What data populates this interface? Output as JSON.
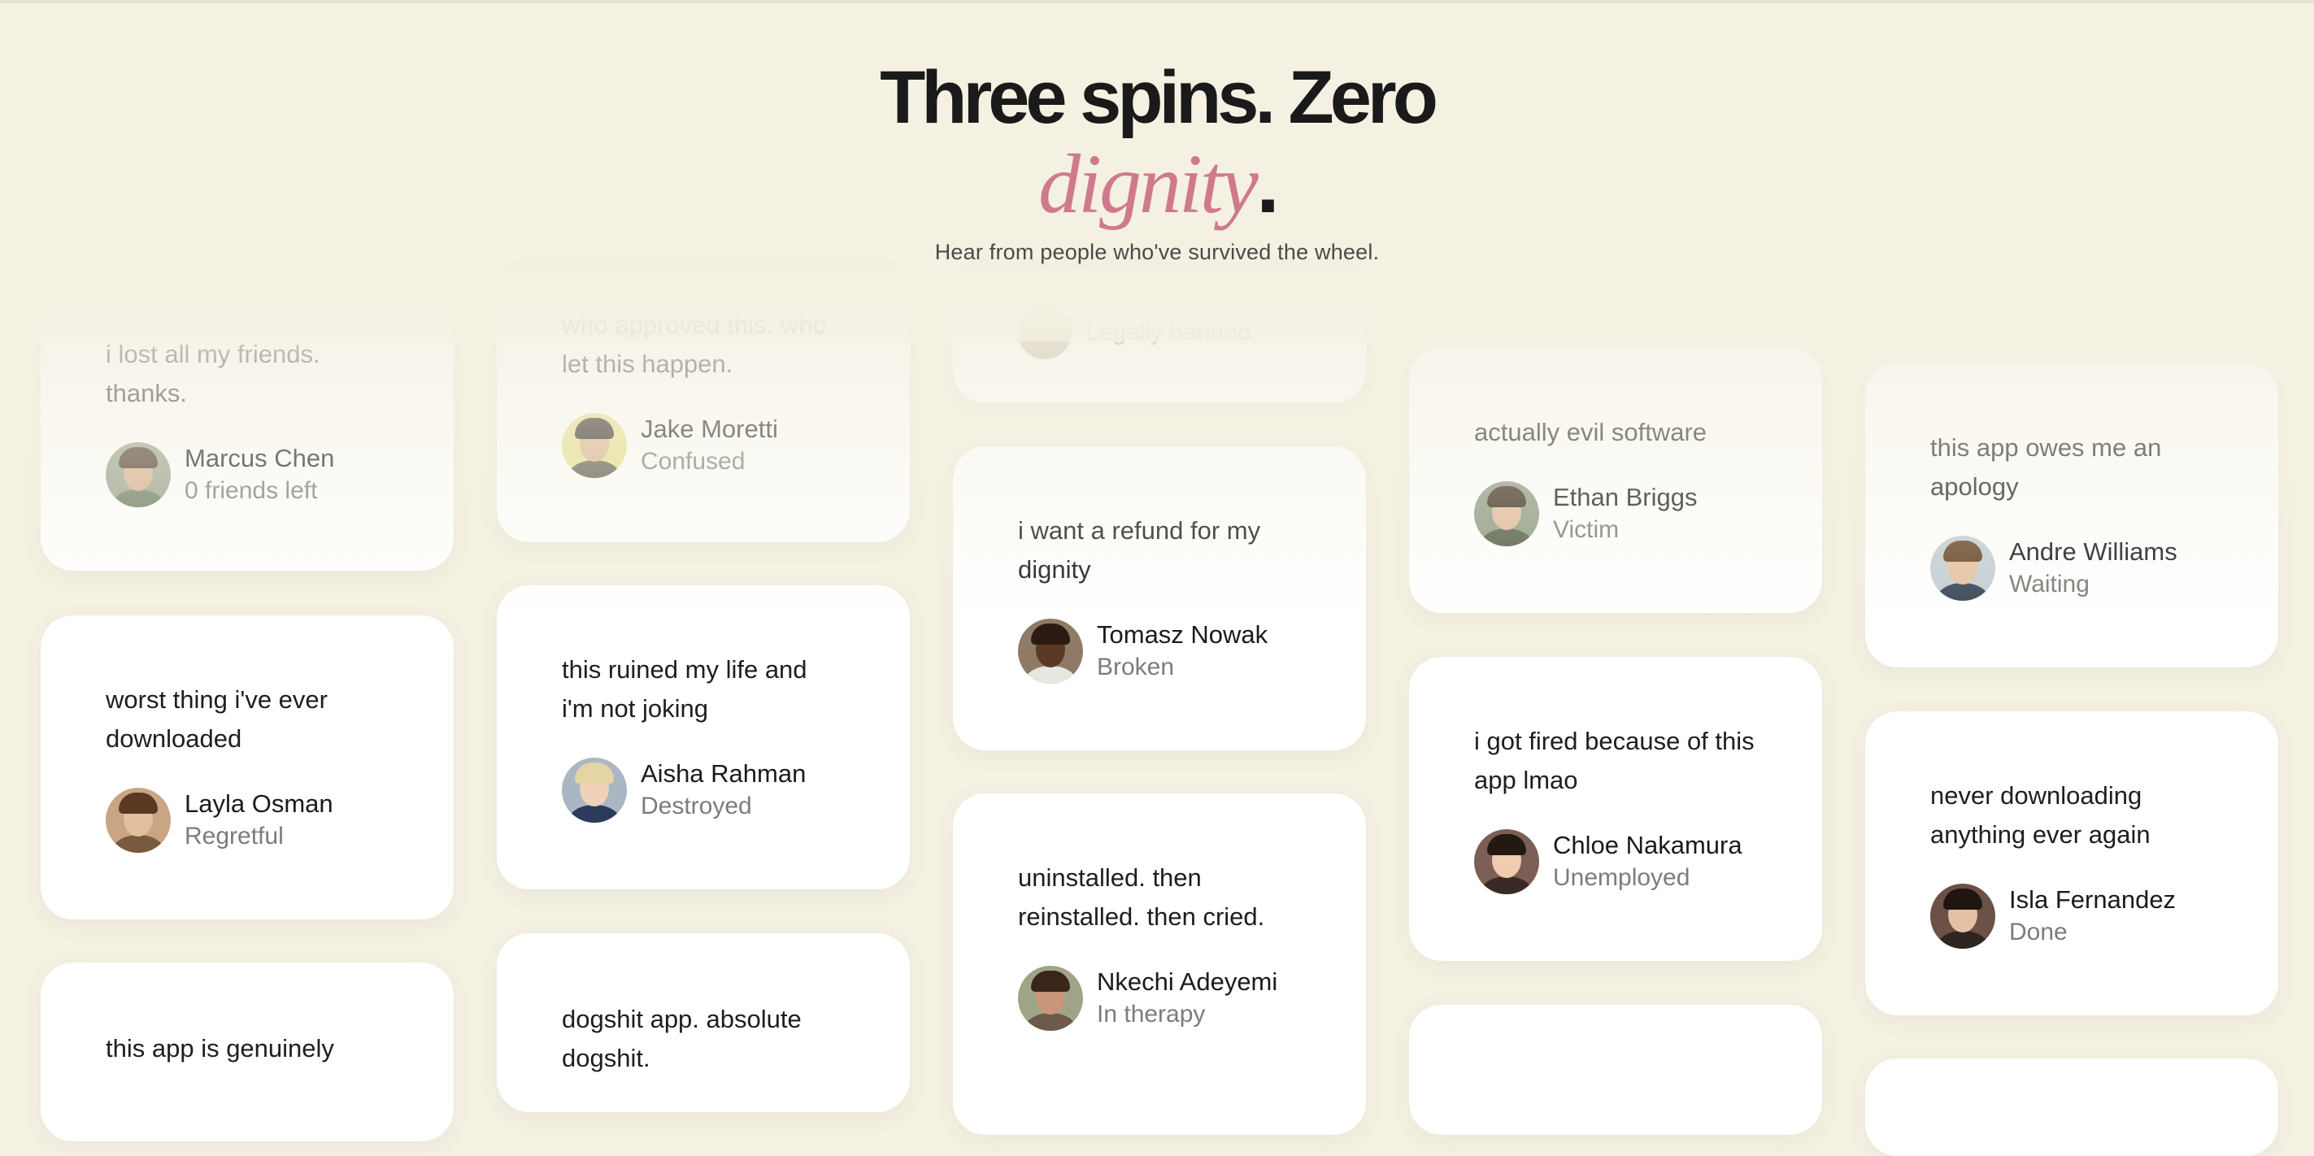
{
  "hero": {
    "title_line1": "Three spins. Zero",
    "title_accent": "dignity",
    "title_dot": ".",
    "subtitle": "Hear from people who've survived the wheel."
  },
  "colors": {
    "background": "#f4f1e3",
    "accent": "#cf7a8c",
    "card": "#ffffff"
  },
  "testimonials": [
    {
      "quote": "i lost all my friends. thanks.",
      "name": "Marcus Chen",
      "role": "0 friends left"
    },
    {
      "quote": "who approved this. who let this happen.",
      "name": "Jake Moretti",
      "role": "Confused"
    },
    {
      "quote": "",
      "name": "",
      "role": "Legally banned"
    },
    {
      "quote": "actually evil software",
      "name": "Ethan Briggs",
      "role": "Victim"
    },
    {
      "quote": "this app owes me an apology",
      "name": "Andre Williams",
      "role": "Waiting"
    },
    {
      "quote": "worst thing i've ever downloaded",
      "name": "Layla Osman",
      "role": "Regretful"
    },
    {
      "quote": "this ruined my life and i'm not joking",
      "name": "Aisha Rahman",
      "role": "Destroyed"
    },
    {
      "quote": "i want a refund for my dignity",
      "name": "Tomasz Nowak",
      "role": "Broken"
    },
    {
      "quote": "i got fired because of this app lmao",
      "name": "Chloe Nakamura",
      "role": "Unemployed"
    },
    {
      "quote": "never downloading anything ever again",
      "name": "Isla Fernandez",
      "role": "Done"
    },
    {
      "quote": "this app is genuinely",
      "name": "",
      "role": ""
    },
    {
      "quote": "dogshit app. absolute dogshit.",
      "name": "",
      "role": ""
    },
    {
      "quote": "uninstalled. then reinstalled. then cried.",
      "name": "Nkechi Adeyemi",
      "role": "In therapy"
    },
    {
      "quote": "",
      "name": "",
      "role": ""
    },
    {
      "quote": "",
      "name": "",
      "role": ""
    }
  ]
}
